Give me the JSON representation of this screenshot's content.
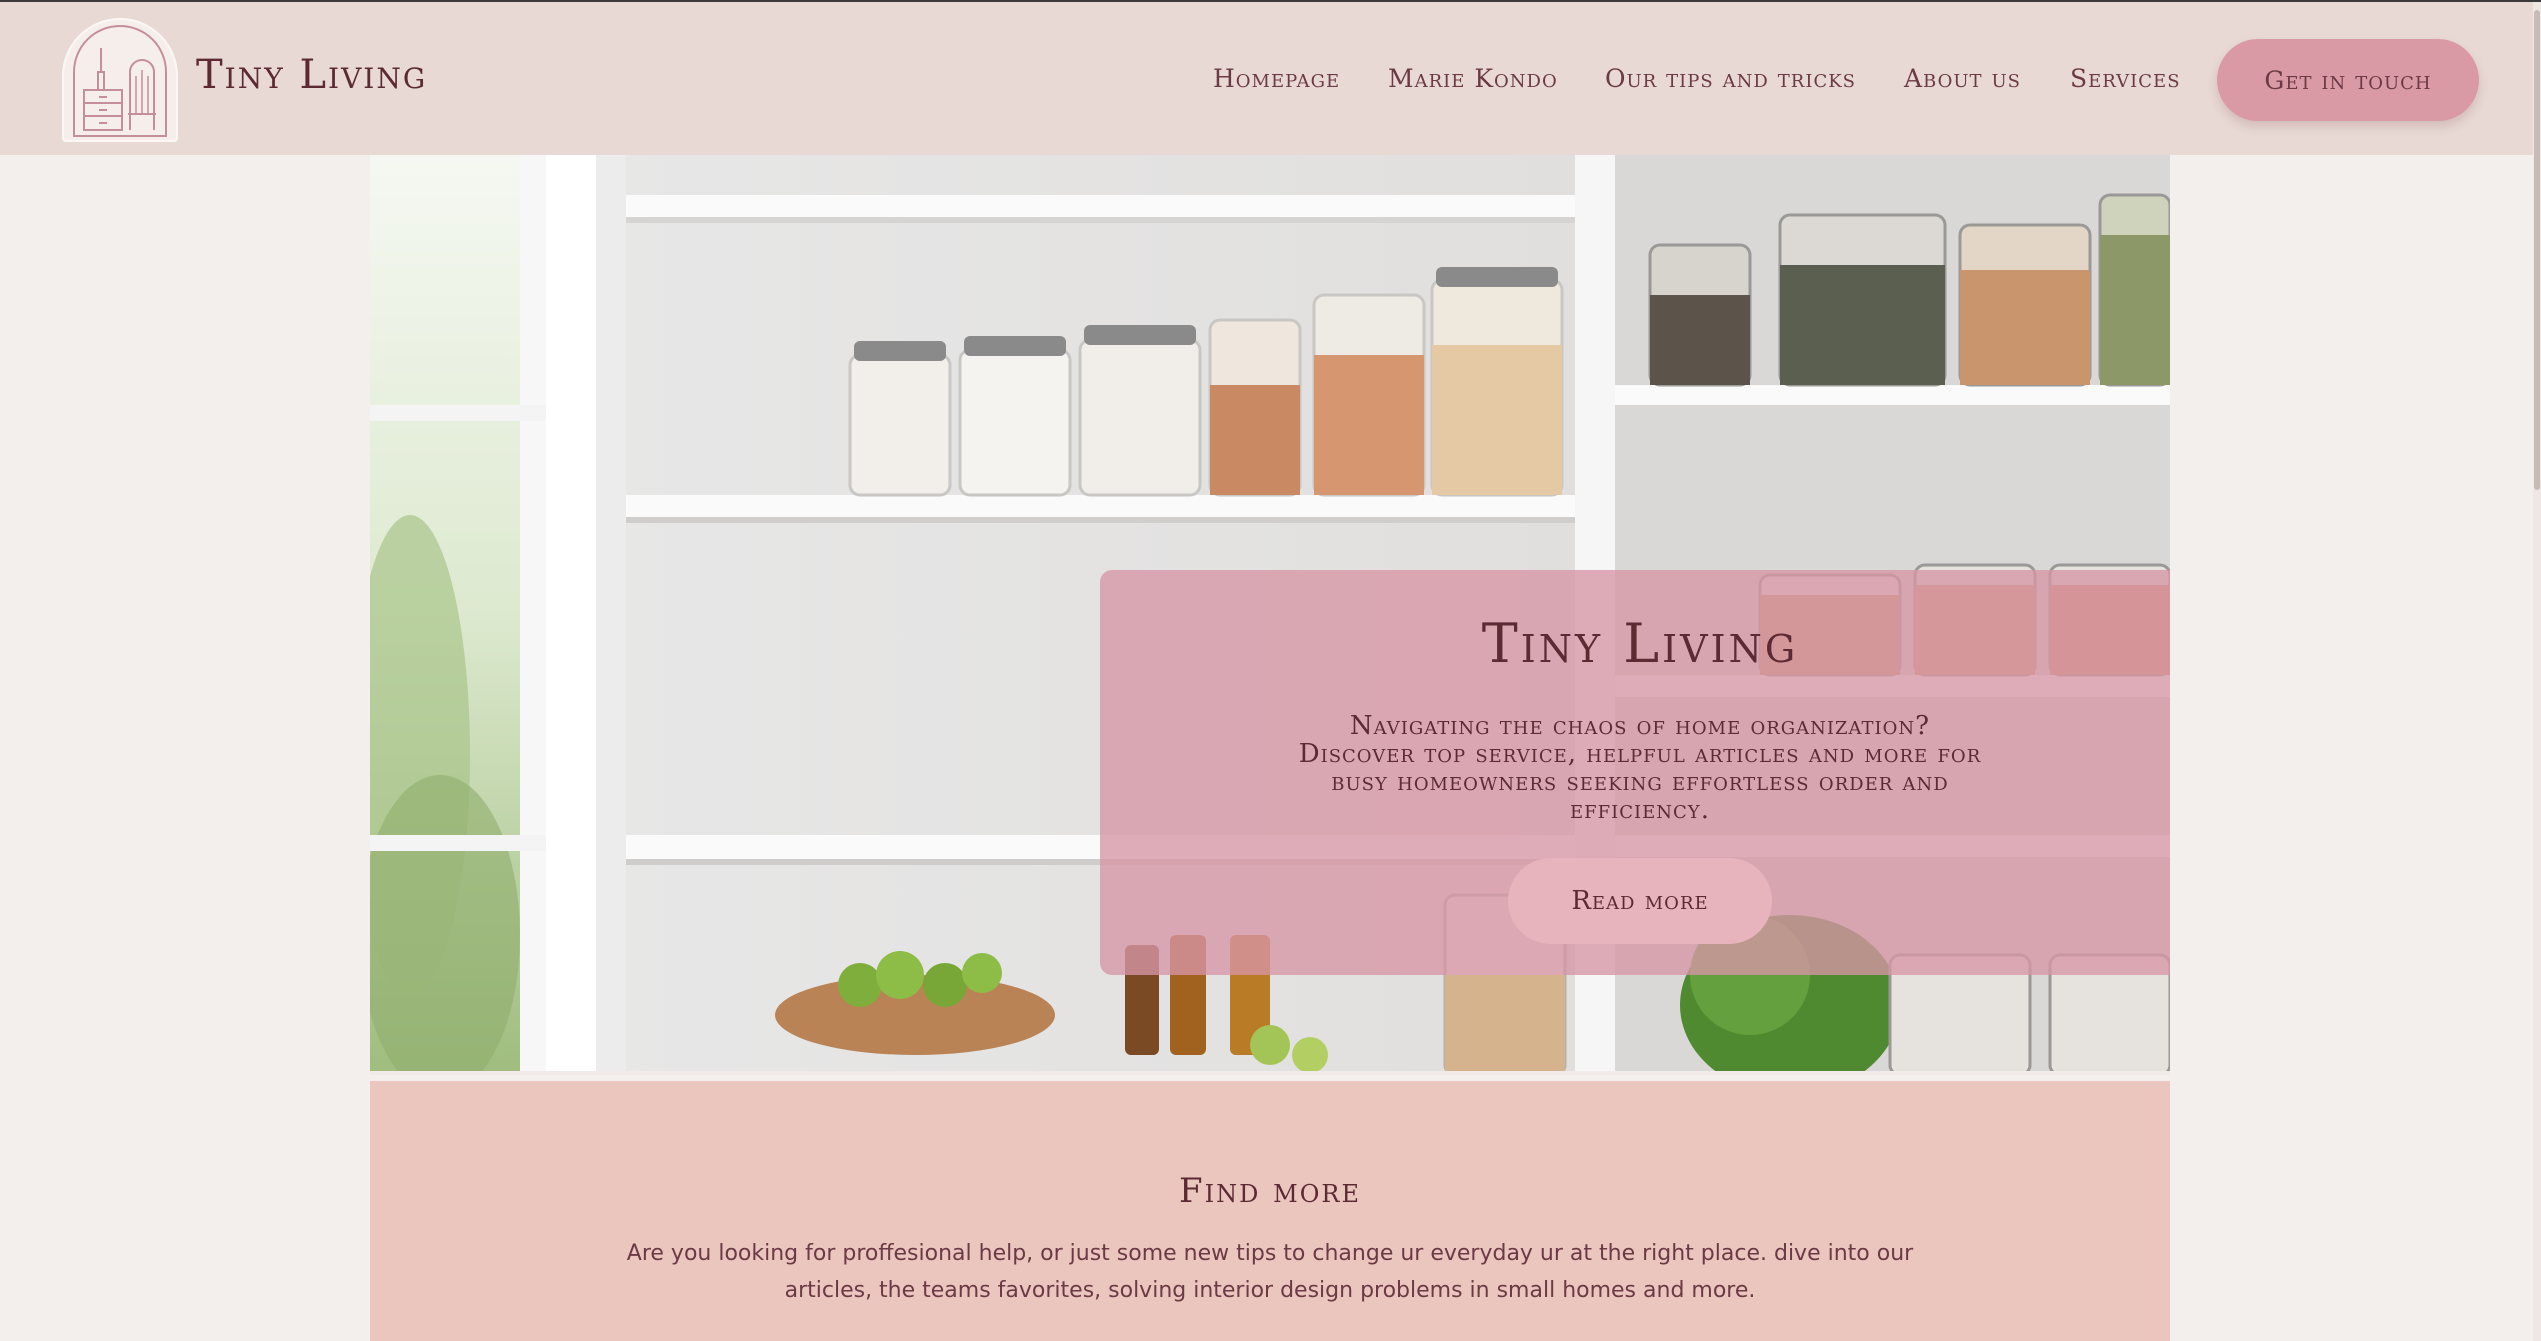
{
  "header": {
    "brand": "Tiny Living",
    "nav": [
      {
        "label": "Homepage"
      },
      {
        "label": "Marie Kondo"
      },
      {
        "label": "Our tips and tricks"
      },
      {
        "label": "About us"
      },
      {
        "label": "Services"
      }
    ],
    "cta_label": "Get in touch"
  },
  "hero": {
    "title": "Tiny Living",
    "text": "Navigating the chaos of home organization? Discover top service, helpful articles and more for busy homeowners seeking effortless order and efficiency.",
    "button_label": "Read more"
  },
  "find_more": {
    "title": "Find more",
    "text": "Are you looking for proffesional help, or just some new tips to change ur everyday ur at the right place. dive into our articles, the teams favorites, solving interior design problems in small homes and more."
  },
  "colors": {
    "header_bg": "#e8d9d4",
    "accent": "#d99aa6",
    "overlay": "#d696a5",
    "section_bg": "#ebc6bf",
    "text": "#5c2a33"
  },
  "icons": {
    "logo": "cabinet-logo-icon"
  }
}
